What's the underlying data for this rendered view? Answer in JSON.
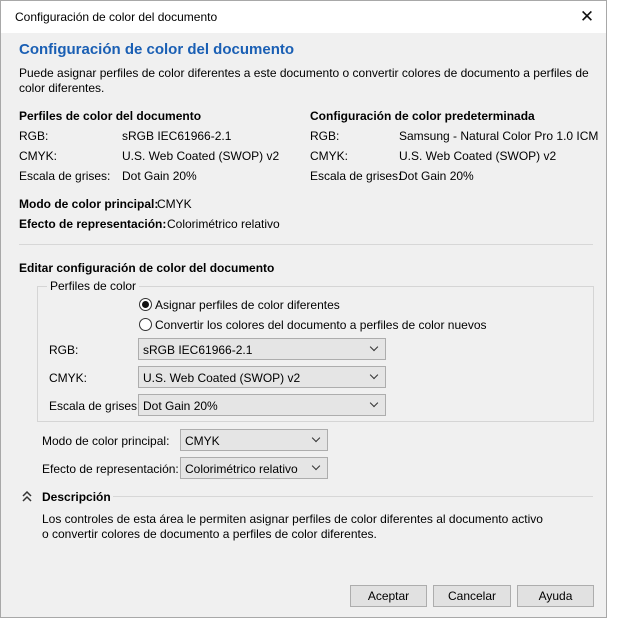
{
  "window": {
    "title": "Configuración de color del documento"
  },
  "header": {
    "title": "Configuración de color del documento",
    "description": "Puede asignar perfiles de color diferentes a este documento o convertir colores de documento a perfiles de color diferentes."
  },
  "document_profiles": {
    "heading": "Perfiles de color del documento",
    "rows": [
      {
        "label": "RGB:",
        "value": "sRGB IEC61966-2.1"
      },
      {
        "label": "CMYK:",
        "value": "U.S. Web Coated (SWOP) v2"
      },
      {
        "label": "Escala de grises:",
        "value": "Dot Gain 20%"
      }
    ]
  },
  "default_settings": {
    "heading": "Configuración de color predeterminada",
    "rows": [
      {
        "label": "RGB:",
        "value": "Samsung - Natural Color Pro 1.0 ICM"
      },
      {
        "label": "CMYK:",
        "value": "U.S. Web Coated (SWOP) v2"
      },
      {
        "label": "Escala de grises:",
        "value": "Dot Gain 20%"
      }
    ]
  },
  "primary_mode": {
    "label": "Modo de color principal:",
    "value": "CMYK"
  },
  "rendering_intent": {
    "label": "Efecto de representación:",
    "value": "Colorimétrico relativo"
  },
  "edit": {
    "heading": "Editar configuración de color del documento",
    "group_label": "Perfiles de color",
    "radio_assign": {
      "label": "Asignar perfiles de color diferentes",
      "selected": true
    },
    "radio_convert": {
      "label": "Convertir los colores del documento a perfiles de color nuevos",
      "selected": false
    },
    "rgb": {
      "label": "RGB:",
      "value": "sRGB IEC61966-2.1"
    },
    "cmyk": {
      "label": "CMYK:",
      "value": "U.S. Web Coated (SWOP) v2"
    },
    "gray": {
      "label": "Escala de grises:",
      "value": "Dot Gain 20%"
    },
    "primary_mode": {
      "label": "Modo de color principal:",
      "value": "CMYK"
    },
    "rendering_intent": {
      "label": "Efecto de representación:",
      "value": "Colorimétrico relativo"
    }
  },
  "description": {
    "heading": "Descripción",
    "line1": "Los controles de esta área le permiten asignar perfiles de color diferentes al documento activo",
    "line2": "o convertir colores de documento a perfiles de color diferentes."
  },
  "buttons": {
    "accept": "Aceptar",
    "cancel": "Cancelar",
    "help": "Ayuda"
  },
  "colors": {
    "accent": "#1a5fb4",
    "dialog_bg": "#f0f0f0"
  }
}
